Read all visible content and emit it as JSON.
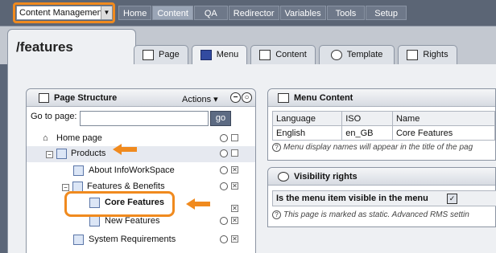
{
  "topbar": {
    "site_select": "Content Managemen",
    "nav": [
      "Home",
      "Content",
      "QA",
      "Redirector",
      "Variables",
      "Tools",
      "Setup"
    ],
    "active_nav": "Content"
  },
  "header": {
    "page_title": "/features",
    "tabs": [
      "Page",
      "Menu",
      "Content",
      "Template",
      "Rights"
    ],
    "active_tab": "Menu"
  },
  "page_structure": {
    "title": "Page Structure",
    "actions_label": "Actions",
    "goto_label": "Go to page:",
    "goto_button": "go",
    "tree": [
      {
        "label": "Home page"
      },
      {
        "label": "Products"
      },
      {
        "label": "About InfoWorkSpace"
      },
      {
        "label": "Features & Benefits"
      },
      {
        "label": "Core Features"
      },
      {
        "label": "New Features"
      },
      {
        "label": "System Requirements"
      }
    ]
  },
  "menu_content": {
    "title": "Menu Content",
    "columns": [
      "Language",
      "ISO",
      "Name"
    ],
    "rows": [
      [
        "English",
        "en_GB",
        "Core Features"
      ]
    ],
    "note": "Menu display names will appear in the title of the pag"
  },
  "visibility": {
    "title": "Visibility rights",
    "question": "Is the menu item visible in the menu",
    "note": "This page is marked as static. Advanced RMS settin"
  },
  "colors": {
    "highlight": "#f08a1e",
    "topbar": "#5b6575",
    "button": "#5d6b83"
  }
}
